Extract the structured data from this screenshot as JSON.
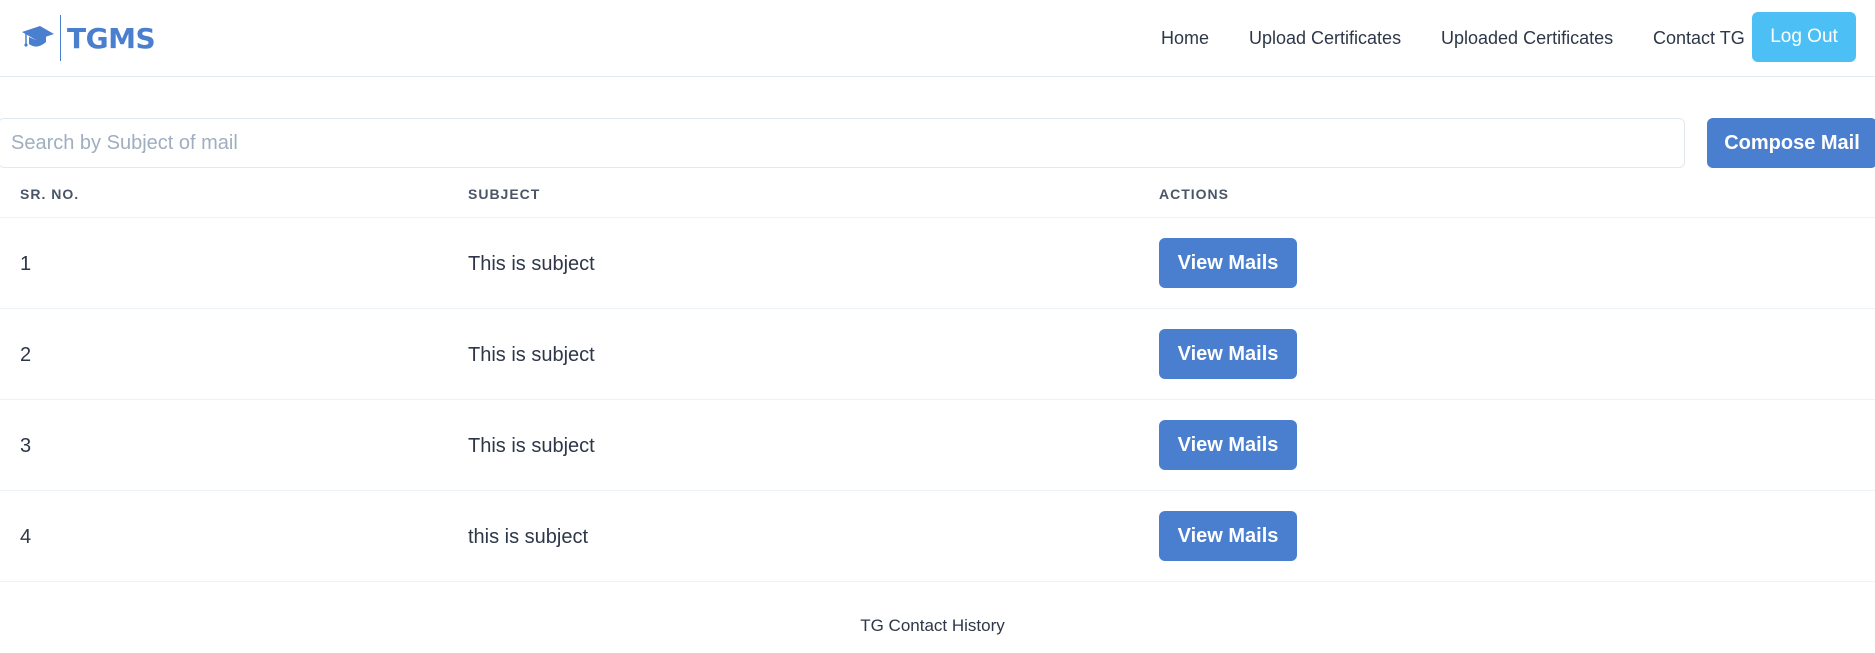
{
  "brand": {
    "name": "TGMS",
    "icon": "graduation-cap-icon",
    "color": "#4a7fcf"
  },
  "nav": {
    "items": [
      {
        "label": "Home"
      },
      {
        "label": "Upload Certificates"
      },
      {
        "label": "Uploaded Certificates"
      },
      {
        "label": "Contact TG"
      }
    ],
    "logout_label": "Log Out",
    "logout_color": "#4cc0f5"
  },
  "search": {
    "placeholder": "Search by Subject of mail",
    "value": ""
  },
  "compose_label": "Compose Mail",
  "table": {
    "headers": [
      "SR. NO.",
      "SUBJECT",
      "ACTIONS"
    ],
    "rows": [
      {
        "sr": "1",
        "subject": "This is subject",
        "action": "View Mails"
      },
      {
        "sr": "2",
        "subject": "This is subject",
        "action": "View Mails"
      },
      {
        "sr": "3",
        "subject": "This is subject",
        "action": "View Mails"
      },
      {
        "sr": "4",
        "subject": "this is subject",
        "action": "View Mails"
      }
    ]
  },
  "footer": {
    "title": "TG Contact History"
  }
}
